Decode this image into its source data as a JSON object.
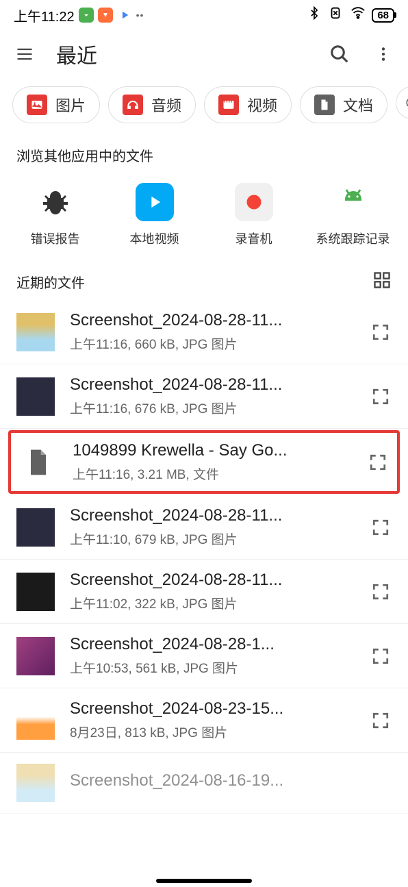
{
  "status": {
    "time": "上午11:22",
    "battery": "68"
  },
  "appbar": {
    "title": "最近"
  },
  "chips": [
    {
      "label": "图片",
      "color": "#e53935"
    },
    {
      "label": "音频",
      "color": "#e53935"
    },
    {
      "label": "视频",
      "color": "#e53935"
    },
    {
      "label": "文档",
      "color": "#616161"
    }
  ],
  "browse_section": "浏览其他应用中的文件",
  "apps": [
    {
      "label": "错误报告"
    },
    {
      "label": "本地视频"
    },
    {
      "label": "录音机"
    },
    {
      "label": "系统跟踪记录"
    }
  ],
  "recent_section": "近期的文件",
  "files": [
    {
      "name": "Screenshot_2024-08-28-11...",
      "meta": "上午11:16, 660 kB, JPG 图片",
      "thumb": "light"
    },
    {
      "name": "Screenshot_2024-08-28-11...",
      "meta": "上午11:16, 676 kB, JPG 图片",
      "thumb": "dark"
    },
    {
      "name": "1049899 Krewella - Say Go...",
      "meta": "上午11:16, 3.21 MB, 文件",
      "thumb": "doc",
      "highlighted": true
    },
    {
      "name": "Screenshot_2024-08-28-11...",
      "meta": "上午11:10, 679 kB, JPG 图片",
      "thumb": "dark"
    },
    {
      "name": "Screenshot_2024-08-28-11...",
      "meta": "上午11:02, 322 kB, JPG 图片",
      "thumb": "dark"
    },
    {
      "name": "Screenshot_2024-08-28-1...",
      "meta": "上午10:53, 561 kB, JPG 图片",
      "thumb": "purple"
    },
    {
      "name": "Screenshot_2024-08-23-15...",
      "meta": "8月23日, 813 kB, JPG 图片",
      "thumb": "orange"
    },
    {
      "name": "Screenshot_2024-08-16-19...",
      "meta": "",
      "thumb": "light"
    }
  ]
}
